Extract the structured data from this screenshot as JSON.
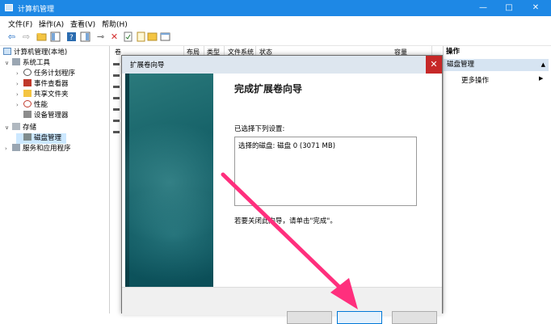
{
  "window": {
    "title": "计算机管理",
    "controls": [
      "—",
      "□",
      "✕"
    ]
  },
  "menu": [
    "文件(F)",
    "操作(A)",
    "查看(V)",
    "帮助(H)"
  ],
  "toolbar_icons": [
    "back-icon",
    "forward-icon",
    "folder-icon",
    "view-icon",
    "help-icon",
    "panel-icon",
    "connect-icon",
    "delete-icon",
    "check-icon",
    "properties-icon",
    "export-icon",
    "window-icon"
  ],
  "tree": {
    "root": "计算机管理(本地)",
    "items": [
      {
        "label": "系统工具",
        "level": 1,
        "expanded": true
      },
      {
        "label": "任务计划程序",
        "level": 2
      },
      {
        "label": "事件查看器",
        "level": 2
      },
      {
        "label": "共享文件夹",
        "level": 2
      },
      {
        "label": "性能",
        "level": 2
      },
      {
        "label": "设备管理器",
        "level": 2
      },
      {
        "label": "存储",
        "level": 1,
        "expanded": true
      },
      {
        "label": "磁盘管理",
        "level": 2,
        "selected": true
      },
      {
        "label": "服务和应用程序",
        "level": 1
      }
    ]
  },
  "columns": [
    "卷",
    "布局",
    "类型",
    "文件系统",
    "状态",
    "容量"
  ],
  "actions": {
    "header": "操作",
    "section": "磁盘管理",
    "more": "更多操作"
  },
  "wizard": {
    "title": "扩展卷向导",
    "heading": "完成扩展卷向导",
    "selected_label": "已选择下列设置:",
    "selected_value": "选择的磁盘: 磁盘 0 (3071 MB)",
    "hint": "若要关闭此向导，请单击\"完成\"。",
    "close": "✕"
  },
  "colors": {
    "titlebar": "#1e88e5",
    "arrow": "#ff2f7d",
    "wizard_side": "#0f5a62"
  }
}
